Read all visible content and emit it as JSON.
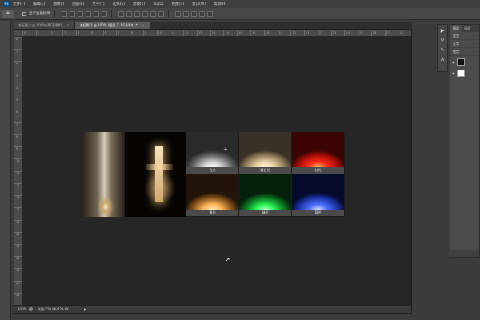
{
  "menu": {
    "logo": "Ps",
    "items": [
      "文件(F)",
      "编辑(E)",
      "图像(I)",
      "图层(L)",
      "文字(Y)",
      "选择(S)",
      "滤镜(T)",
      "3D(D)",
      "视图(V)",
      "窗口(W)",
      "帮助(H)"
    ]
  },
  "options_bar": {
    "auto_select_label": "显示变换控件"
  },
  "tabs": [
    {
      "label": "未标题-2 @ 100% (RGB/8#)"
    },
    {
      "label": "未标题-3 @ 100% (图层 1, RGB/8#) *"
    }
  ],
  "ruler": {
    "top": [
      "0",
      "1",
      "2",
      "3",
      "4",
      "5",
      "6",
      "7",
      "8",
      "9",
      "10",
      "11",
      "12",
      "13",
      "14",
      "15",
      "16",
      "17",
      "18",
      "19",
      "20",
      "21",
      "22",
      "23",
      "24",
      "25",
      "26",
      "27",
      "28"
    ],
    "left": [
      "0",
      "1",
      "2",
      "3",
      "4",
      "5",
      "6",
      "7",
      "8",
      "9",
      "10",
      "11",
      "12",
      "13",
      "14",
      "15",
      "16",
      "17",
      "18",
      "19",
      "20",
      "21"
    ]
  },
  "image": {
    "captions": [
      "白光",
      "暖白光",
      "红光",
      "黄光",
      "绿光",
      "蓝光"
    ],
    "colors": {
      "white": "#f4f4f4",
      "warm_white": "#f6e2b0",
      "red": "#ff2a14",
      "yellow": "#ffb45a",
      "green": "#2dff5a",
      "blue": "#4a6dff"
    }
  },
  "status": {
    "zoom": "100%",
    "doc_info": "文档:729.8K/729.8K"
  },
  "panel": {
    "tabs": [
      "图层",
      "通道"
    ],
    "kind_label": "类型",
    "mode": "正常",
    "opacity_label": "不透明度:",
    "fill_label": "填充:",
    "lock_label": "锁定:"
  }
}
